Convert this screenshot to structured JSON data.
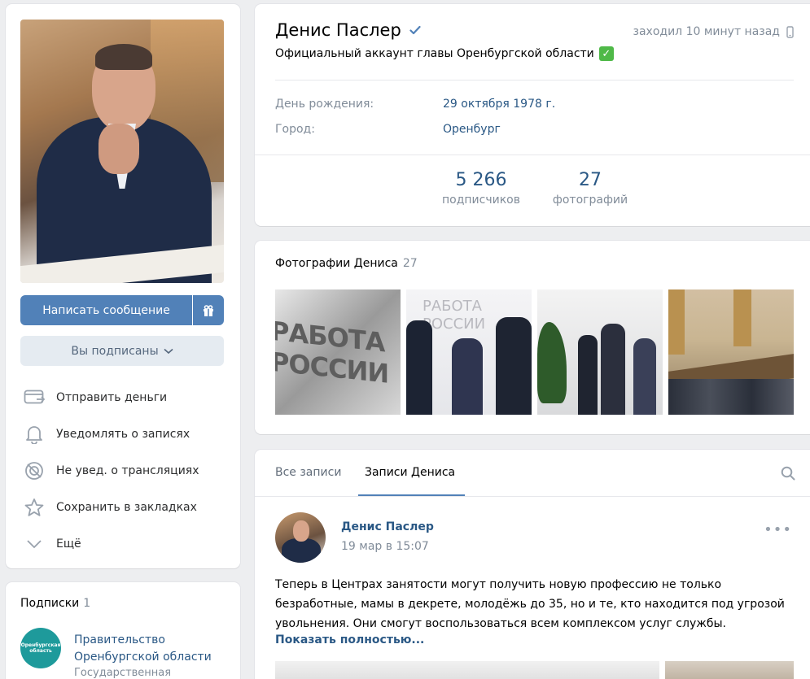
{
  "profile": {
    "name": "Денис Паслер",
    "status": "Официальный аккаунт главы Оренбургской области",
    "online": "заходил 10 минут назад",
    "birthday_label": "День рождения:",
    "birthday_value": "29 октября 1978 г.",
    "city_label": "Город:",
    "city_value": "Оренбург",
    "counters": [
      {
        "num": "5 266",
        "label": "подписчиков"
      },
      {
        "num": "27",
        "label": "фотографий"
      }
    ]
  },
  "left": {
    "message_button": "Написать сообщение",
    "subscribed_button": "Вы подписаны",
    "actions": [
      {
        "label": "Отправить деньги",
        "icon": "money-transfer-icon"
      },
      {
        "label": "Уведомлять о записях",
        "icon": "bell-icon"
      },
      {
        "label": "Не увед. о трансляциях",
        "icon": "broadcast-off-icon"
      },
      {
        "label": "Сохранить в закладках",
        "icon": "star-icon"
      },
      {
        "label": "Ещё",
        "icon": "chevron-down-icon"
      }
    ]
  },
  "subscriptions": {
    "title": "Подписки",
    "count": "1",
    "logo_text": "Оренбургская область",
    "item_name_line1": "Правительство",
    "item_name_line2": "Оренбургской области",
    "item_sub": "Государственная"
  },
  "photos": {
    "title": "Фотографии Дениса",
    "count": "27",
    "thumb1_text": "РАБОТА РОССИИ",
    "thumb2_text": "РАБОТА РОССИИ"
  },
  "wall": {
    "tabs": [
      "Все записи",
      "Записи Дениса"
    ],
    "post": {
      "author": "Денис Паслер",
      "time": "19 мар в 15:07",
      "text": "Теперь в Центрах занятости могут получить новую профессию не только безработные, мамы в декрете, молодёжь до 35, но и те, кто находится под угрозой увольнения. Они смогут воспользоваться всем комплексом услуг службы.",
      "show_more": "Показать полностью..."
    }
  },
  "colors": {
    "accent": "#5181b8",
    "link": "#2a5885",
    "muted": "#818c99",
    "verified_check": "#4fb948",
    "gov_logo": "#1e9a9b"
  }
}
